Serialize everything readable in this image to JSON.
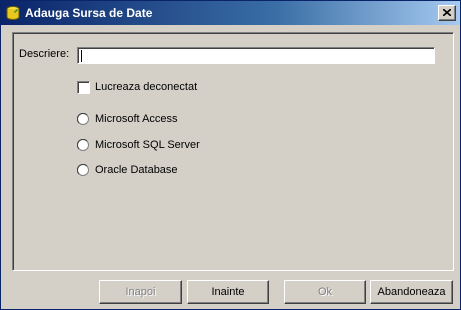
{
  "window": {
    "title": "Adauga Sursa de Date"
  },
  "form": {
    "description_label": "Descriere:",
    "description_value": "",
    "offline_checkbox_label": "Lucreaza deconectat",
    "offline_checked": false,
    "options": [
      {
        "label": "Microsoft Access",
        "selected": false
      },
      {
        "label": "Microsoft SQL Server",
        "selected": false
      },
      {
        "label": "Oracle Database",
        "selected": false
      }
    ]
  },
  "buttons": {
    "back": "Inapoi",
    "next": "Inainte",
    "ok": "Ok",
    "cancel": "Abandoneaza"
  }
}
